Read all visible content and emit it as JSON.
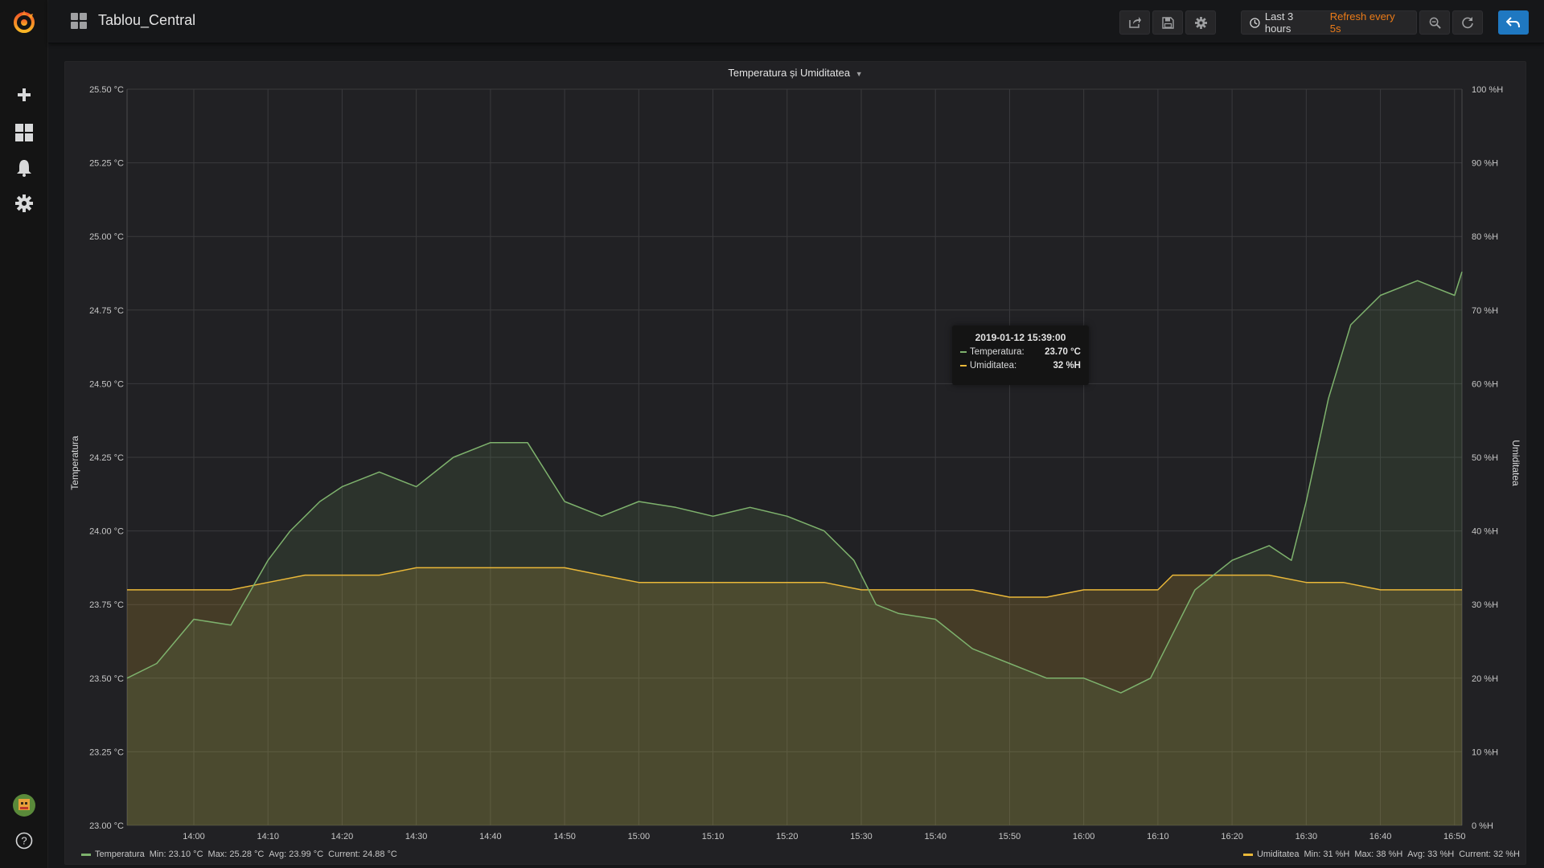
{
  "dashboard": {
    "title": "Tablou_Central"
  },
  "timepicker": {
    "range_label": "Last 3 hours",
    "refresh_label": "Refresh every 5s"
  },
  "panel": {
    "title": "Temperatura și Umiditatea"
  },
  "axes": {
    "left_label": "Temperatura",
    "right_label": "Umiditatea",
    "left_ticks": [
      "25.50 °C",
      "25.25 °C",
      "25.00 °C",
      "24.75 °C",
      "24.50 °C",
      "24.25 °C",
      "24.00 °C",
      "23.75 °C",
      "23.50 °C",
      "23.25 °C",
      "23.00 °C"
    ],
    "right_ticks": [
      "100 %H",
      "90 %H",
      "80 %H",
      "70 %H",
      "60 %H",
      "50 %H",
      "40 %H",
      "30 %H",
      "20 %H",
      "10 %H",
      "0 %H"
    ],
    "x_ticks": [
      "14:00",
      "14:10",
      "14:20",
      "14:30",
      "14:40",
      "14:50",
      "15:00",
      "15:10",
      "15:20",
      "15:30",
      "15:40",
      "15:50",
      "16:00",
      "16:10",
      "16:20",
      "16:30",
      "16:40",
      "16:50"
    ]
  },
  "tooltip": {
    "time": "2019-01-12 15:39:00",
    "rows": [
      {
        "name": "Temperatura:",
        "value": "23.70 °C"
      },
      {
        "name": "Umiditatea:",
        "value": "32 %H"
      }
    ]
  },
  "legend": {
    "temp": {
      "name": "Temperatura",
      "min": "Min: 23.10 °C",
      "max": "Max: 25.28 °C",
      "avg": "Avg: 23.99 °C",
      "current": "Current: 24.88 °C"
    },
    "hum": {
      "name": "Umiditatea",
      "min": "Min: 31 %H",
      "max": "Max: 38 %H",
      "avg": "Avg: 33 %H",
      "current": "Current: 32 %H"
    }
  },
  "colors": {
    "temperature": "#7eb26d",
    "humidity": "#eab839",
    "accent": "#eb7b18",
    "primary_button": "#1f78c1"
  },
  "chart_data": {
    "type": "line",
    "title": "Temperatura și Umiditatea",
    "ylabel": "Temperatura",
    "y2label": "Umiditatea",
    "ylim": [
      23.0,
      25.5
    ],
    "y2lim": [
      0,
      100
    ],
    "xlim": [
      "13:51",
      "16:51"
    ],
    "grid": true,
    "legend_position": "bottom",
    "series": [
      {
        "name": "Temperatura",
        "axis": "left",
        "unit": "°C",
        "fill": true,
        "x": [
          "13:51",
          "13:55",
          "14:00",
          "14:05",
          "14:10",
          "14:13",
          "14:17",
          "14:20",
          "14:25",
          "14:30",
          "14:35",
          "14:40",
          "14:45",
          "14:50",
          "14:55",
          "15:00",
          "15:05",
          "15:10",
          "15:15",
          "15:20",
          "15:25",
          "15:29",
          "15:32",
          "15:35",
          "15:40",
          "15:45",
          "15:50",
          "15:55",
          "16:00",
          "16:05",
          "16:09",
          "16:12",
          "16:15",
          "16:20",
          "16:25",
          "16:28",
          "16:30",
          "16:33",
          "16:36",
          "16:40",
          "16:45",
          "16:50",
          "16:51"
        ],
        "values": [
          23.5,
          23.55,
          23.7,
          23.68,
          23.9,
          24.0,
          24.1,
          24.15,
          24.2,
          24.15,
          24.25,
          24.3,
          24.3,
          24.1,
          24.05,
          24.1,
          24.08,
          24.05,
          24.08,
          24.05,
          24.0,
          23.9,
          23.75,
          23.72,
          23.7,
          23.6,
          23.55,
          23.5,
          23.5,
          23.45,
          23.5,
          23.65,
          23.8,
          23.9,
          23.95,
          23.9,
          24.1,
          24.45,
          24.7,
          24.8,
          24.85,
          24.8,
          24.88
        ]
      },
      {
        "name": "Umiditatea",
        "axis": "right",
        "unit": "%H",
        "fill": true,
        "x": [
          "13:51",
          "14:00",
          "14:05",
          "14:10",
          "14:15",
          "14:20",
          "14:25",
          "14:30",
          "14:35",
          "14:40",
          "14:45",
          "14:50",
          "14:55",
          "15:00",
          "15:05",
          "15:10",
          "15:15",
          "15:20",
          "15:25",
          "15:30",
          "15:35",
          "15:40",
          "15:45",
          "15:50",
          "15:55",
          "16:00",
          "16:05",
          "16:10",
          "16:12",
          "16:15",
          "16:20",
          "16:25",
          "16:30",
          "16:35",
          "16:40",
          "16:45",
          "16:50",
          "16:51"
        ],
        "values": [
          32,
          32,
          32,
          33,
          34,
          34,
          34,
          35,
          35,
          35,
          35,
          35,
          34,
          33,
          33,
          33,
          33,
          33,
          33,
          32,
          32,
          32,
          32,
          31,
          31,
          32,
          32,
          32,
          34,
          34,
          34,
          34,
          33,
          33,
          32,
          32,
          32,
          32
        ]
      }
    ]
  }
}
